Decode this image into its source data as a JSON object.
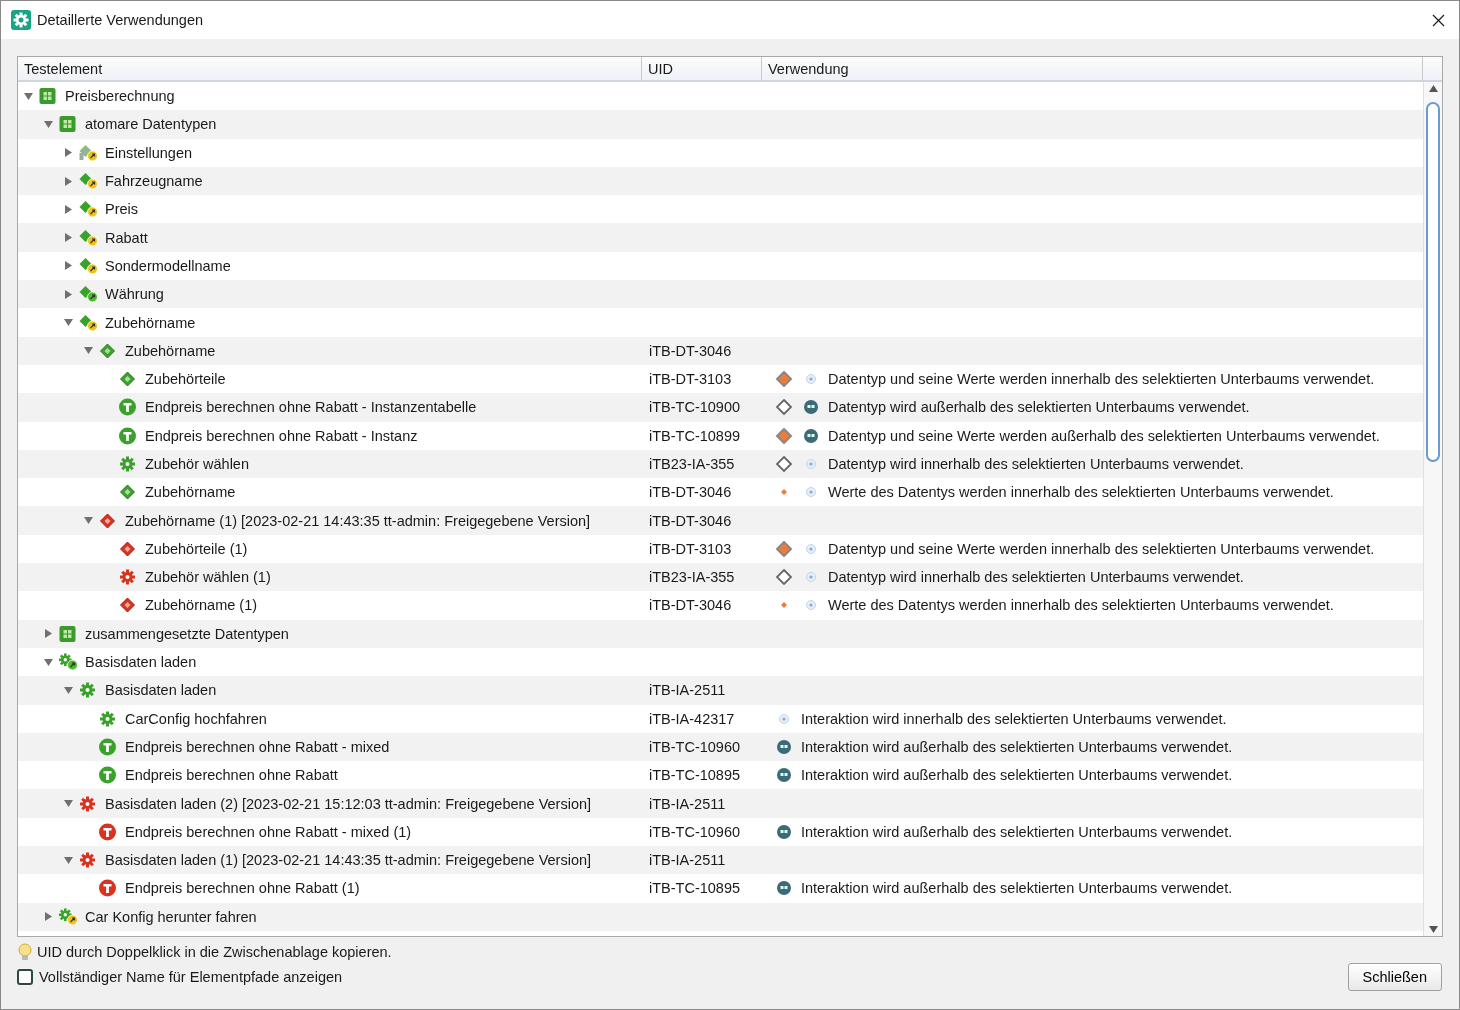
{
  "window": {
    "title": "Detaillerte Verwendungen"
  },
  "table": {
    "columns": [
      "Testelement",
      "UID",
      "Verwendung"
    ],
    "tree": [
      {
        "label": "Preisberechnung",
        "kind": "package",
        "expanded": true,
        "children": [
          {
            "label": "atomare Datentypen",
            "kind": "package",
            "expanded": true,
            "children": [
              {
                "label": "Einstellungen",
                "kind": "ref-gray",
                "expanded": false
              },
              {
                "label": "Fahrzeugname",
                "kind": "ref-yellow",
                "expanded": false
              },
              {
                "label": "Preis",
                "kind": "ref-yellow",
                "expanded": false
              },
              {
                "label": "Rabatt",
                "kind": "ref-yellow",
                "expanded": false
              },
              {
                "label": "Sondermodellname",
                "kind": "ref-yellow",
                "expanded": false
              },
              {
                "label": "Währung",
                "kind": "ref-green",
                "expanded": false
              },
              {
                "label": "Zubehörname",
                "kind": "ref-yellow",
                "expanded": true,
                "children": [
                  {
                    "label": "Zubehörname",
                    "kind": "diamond-green",
                    "uid": "iTB-DT-3046",
                    "expanded": true,
                    "children": [
                      {
                        "label": "Zubehörteile",
                        "kind": "diamond-green",
                        "uid": "iTB-DT-3103",
                        "marks": [
                          {
                            "kind": "value-filled"
                          },
                          {
                            "kind": "scope-inner"
                          }
                        ],
                        "usage": "Datentyp und seine Werte werden innerhalb des selektierten Unterbaums verwendet."
                      },
                      {
                        "label": "Endpreis berechnen ohne Rabatt - Instanzentabelle",
                        "kind": "test-green",
                        "uid": "iTB-TC-10900",
                        "marks": [
                          {
                            "kind": "value-empty"
                          },
                          {
                            "kind": "scope-outer"
                          }
                        ],
                        "usage": "Datentyp wird außerhalb des selektierten Unterbaums verwendet."
                      },
                      {
                        "label": "Endpreis berechnen ohne Rabatt - Instanz",
                        "kind": "test-green",
                        "uid": "iTB-TC-10899",
                        "marks": [
                          {
                            "kind": "value-filled"
                          },
                          {
                            "kind": "scope-outer"
                          }
                        ],
                        "usage": "Datentyp und seine Werte werden außerhalb des selektierten Unterbaums verwendet."
                      },
                      {
                        "label": "Zubehör wählen",
                        "kind": "gear-green",
                        "uid": "iTB23-IA-355",
                        "marks": [
                          {
                            "kind": "value-empty"
                          },
                          {
                            "kind": "scope-inner"
                          }
                        ],
                        "usage": "Datentyp wird innerhalb des selektierten Unterbaums verwendet."
                      },
                      {
                        "label": "Zubehörname",
                        "kind": "diamond-green",
                        "uid": "iTB-DT-3046",
                        "marks": [
                          {
                            "kind": "value-dot"
                          },
                          {
                            "kind": "scope-inner"
                          }
                        ],
                        "usage": "Werte des Datentys werden innerhalb des selektierten Unterbaums verwendet."
                      }
                    ]
                  },
                  {
                    "label": "Zubehörname (1) [2023-02-21 14:43:35 tt-admin: Freigegebene Version]",
                    "kind": "diamond-red",
                    "uid": "iTB-DT-3046",
                    "expanded": true,
                    "children": [
                      {
                        "label": "Zubehörteile (1)",
                        "kind": "diamond-red",
                        "uid": "iTB-DT-3103",
                        "marks": [
                          {
                            "kind": "value-filled"
                          },
                          {
                            "kind": "scope-inner"
                          }
                        ],
                        "usage": "Datentyp und seine Werte werden innerhalb des selektierten Unterbaums verwendet."
                      },
                      {
                        "label": "Zubehör wählen (1)",
                        "kind": "gear-red",
                        "uid": "iTB23-IA-355",
                        "marks": [
                          {
                            "kind": "value-empty"
                          },
                          {
                            "kind": "scope-inner"
                          }
                        ],
                        "usage": "Datentyp wird innerhalb des selektierten Unterbaums verwendet."
                      },
                      {
                        "label": "Zubehörname (1)",
                        "kind": "diamond-red",
                        "uid": "iTB-DT-3046",
                        "marks": [
                          {
                            "kind": "value-dot"
                          },
                          {
                            "kind": "scope-inner"
                          }
                        ],
                        "usage": "Werte des Datentys werden innerhalb des selektierten Unterbaums verwendet."
                      }
                    ]
                  }
                ]
              }
            ]
          },
          {
            "label": "zusammengesetzte Datentypen",
            "kind": "package",
            "expanded": false
          },
          {
            "label": "Basisdaten laden",
            "kind": "gear-ref-green",
            "expanded": true,
            "children": [
              {
                "label": "Basisdaten laden",
                "kind": "gear-green",
                "uid": "iTB-IA-2511",
                "expanded": true,
                "children": [
                  {
                    "label": "CarConfig hochfahren",
                    "kind": "gear-green",
                    "uid": "iTB-IA-42317",
                    "marks": [
                      {
                        "kind": "scope-inner"
                      }
                    ],
                    "usage": "Interaktion wird innerhalb des selektierten Unterbaums verwendet."
                  },
                  {
                    "label": "Endpreis berechnen ohne Rabatt - mixed",
                    "kind": "test-green",
                    "uid": "iTB-TC-10960",
                    "marks": [
                      {
                        "kind": "scope-outer"
                      }
                    ],
                    "usage": "Interaktion wird außerhalb des selektierten Unterbaums verwendet."
                  },
                  {
                    "label": "Endpreis berechnen ohne Rabatt",
                    "kind": "test-green",
                    "uid": "iTB-TC-10895",
                    "marks": [
                      {
                        "kind": "scope-outer"
                      }
                    ],
                    "usage": "Interaktion wird außerhalb des selektierten Unterbaums verwendet."
                  }
                ]
              },
              {
                "label": "Basisdaten laden (2) [2023-02-21 15:12:03 tt-admin: Freigegebene Version]",
                "kind": "gear-red",
                "uid": "iTB-IA-2511",
                "expanded": true,
                "children": [
                  {
                    "label": "Endpreis berechnen ohne Rabatt - mixed (1)",
                    "kind": "test-red",
                    "uid": "iTB-TC-10960",
                    "marks": [
                      {
                        "kind": "scope-outer"
                      }
                    ],
                    "usage": "Interaktion wird außerhalb des selektierten Unterbaums verwendet."
                  }
                ]
              },
              {
                "label": "Basisdaten laden (1) [2023-02-21 14:43:35 tt-admin: Freigegebene Version]",
                "kind": "gear-red",
                "uid": "iTB-IA-2511",
                "expanded": true,
                "children": [
                  {
                    "label": "Endpreis berechnen ohne Rabatt (1)",
                    "kind": "test-red",
                    "uid": "iTB-TC-10895",
                    "marks": [
                      {
                        "kind": "scope-outer"
                      }
                    ],
                    "usage": "Interaktion wird außerhalb des selektierten Unterbaums verwendet."
                  }
                ]
              }
            ]
          },
          {
            "label": "Car Konfig herunter fahren",
            "kind": "gear-ref-yellow",
            "expanded": false
          }
        ]
      }
    ]
  },
  "hint": "UID durch Doppelklick in die Zwischenablage kopieren.",
  "option": {
    "label": "Vollständiger Name für Elementpfade anzeigen",
    "checked": false
  },
  "buttons": [
    "Schließen"
  ]
}
